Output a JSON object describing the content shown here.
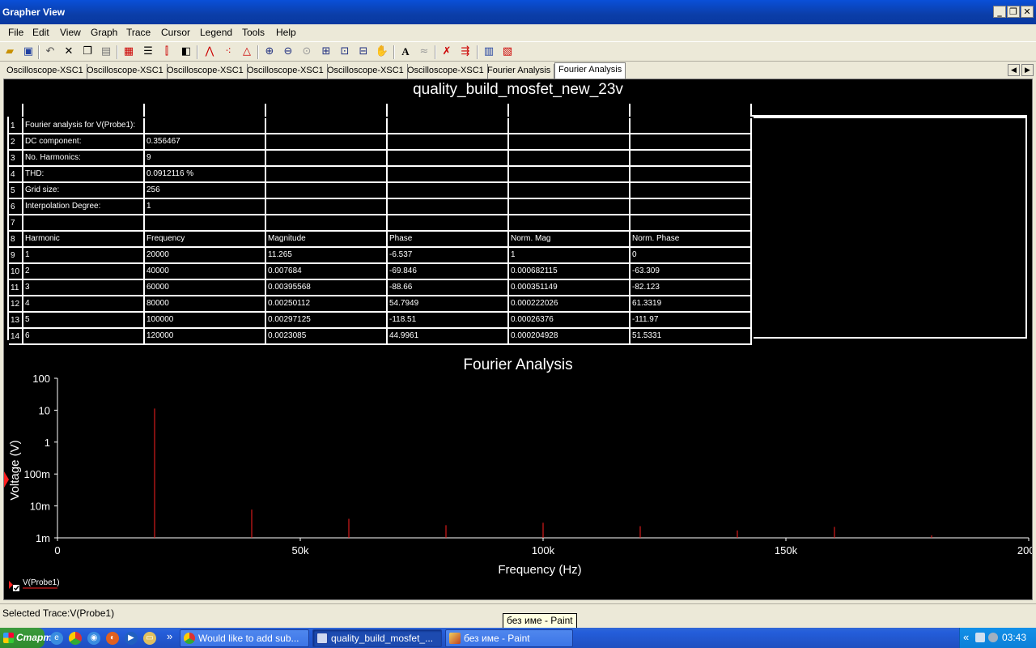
{
  "window": {
    "title": "Grapher View",
    "buttons": {
      "minimize": "_",
      "restore": "❐",
      "close": "✕"
    }
  },
  "menu": [
    "File",
    "Edit",
    "View",
    "Graph",
    "Trace",
    "Cursor",
    "Legend",
    "Tools",
    "Help"
  ],
  "toolbar_icons": [
    "open-icon",
    "save-icon",
    "undo-icon",
    "cut-icon",
    "copy-icon",
    "paste-icon",
    "grid-icon",
    "legend-icon",
    "cursors-icon",
    "overlay-icon",
    "lines-icon",
    "dots-icon",
    "lines-dots-icon",
    "zoom-in-icon",
    "zoom-out-icon",
    "zoom-full-icon",
    "zoom-area-icon",
    "zoom-x-icon",
    "zoom-y-icon",
    "pan-icon",
    "text-icon",
    "trace-label-icon",
    "trace-props-icon",
    "export-icon",
    "clipboard-icon",
    "print-icon"
  ],
  "tabs": [
    "Oscilloscope-XSC1",
    "Oscilloscope-XSC1",
    "Oscilloscope-XSC1",
    "Oscilloscope-XSC1",
    "Oscilloscope-XSC1",
    "Oscilloscope-XSC1",
    "Fourier Analysis",
    "Fourier Analysis"
  ],
  "tab_nav": {
    "prev": "◀",
    "next": "▶"
  },
  "document_title": "quality_build_mosfet_new_23v",
  "table": {
    "rows": [
      [
        "1",
        "Fourier analysis for V(Probe1):",
        "",
        "",
        "",
        "",
        ""
      ],
      [
        "2",
        "DC component:",
        "0.356467",
        "",
        "",
        "",
        ""
      ],
      [
        "3",
        "No. Harmonics:",
        "9",
        "",
        "",
        "",
        ""
      ],
      [
        "4",
        "THD:",
        "0.0912116 %",
        "",
        "",
        "",
        ""
      ],
      [
        "5",
        "Grid size:",
        "256",
        "",
        "",
        "",
        ""
      ],
      [
        "6",
        "Interpolation Degree:",
        "1",
        "",
        "",
        "",
        ""
      ],
      [
        "7",
        "",
        "",
        "",
        "",
        "",
        ""
      ],
      [
        "8",
        "Harmonic",
        "Frequency",
        "Magnitude",
        "Phase",
        "Norm. Mag",
        "Norm. Phase"
      ],
      [
        "9",
        "1",
        "20000",
        "11.265",
        "-6.537",
        "1",
        "0"
      ],
      [
        "10",
        "2",
        "40000",
        "0.007684",
        "-69.846",
        "0.000682115",
        "-63.309"
      ],
      [
        "11",
        "3",
        "60000",
        "0.00395568",
        "-88.66",
        "0.000351149",
        "-82.123"
      ],
      [
        "12",
        "4",
        "80000",
        "0.00250112",
        "54.7949",
        "0.000222026",
        "61.3319"
      ],
      [
        "13",
        "5",
        "100000",
        "0.00297125",
        "-118.51",
        "0.00026376",
        "-111.97"
      ],
      [
        "14",
        "6",
        "120000",
        "0.0023085",
        "44.9961",
        "0.000204928",
        "51.5331"
      ]
    ]
  },
  "chart_data": {
    "type": "bar",
    "title": "Fourier Analysis",
    "xlabel": "Frequency (Hz)",
    "ylabel": "Voltage (V)",
    "yscale": "log",
    "xlim": [
      0,
      200000
    ],
    "ylim": [
      0.001,
      100
    ],
    "x_ticks": [
      "0",
      "50k",
      "100k",
      "150k",
      "200k"
    ],
    "x_tick_values": [
      0,
      50000,
      100000,
      150000,
      200000
    ],
    "y_ticks": [
      "100",
      "10",
      "1",
      "100m",
      "10m",
      "1m"
    ],
    "y_tick_values": [
      100,
      10,
      1,
      0.1,
      0.01,
      0.001
    ],
    "series": [
      {
        "name": "V(Probe1)",
        "color": "#ff2020",
        "x": [
          20000,
          40000,
          60000,
          80000,
          100000,
          120000,
          140000,
          160000,
          180000
        ],
        "values": [
          11.265,
          0.007684,
          0.00395568,
          0.00250112,
          0.00297125,
          0.0023085,
          0.0017,
          0.0022,
          0.0012
        ]
      }
    ],
    "grid": false,
    "legend": "bottom-left"
  },
  "legend": {
    "label": "V(Probe1)"
  },
  "status": {
    "text": "Selected Trace:V(Probe1)"
  },
  "tooltip": "без име - Paint",
  "taskbar": {
    "start": "Старт",
    "overflow": "»",
    "tasks": [
      "Would like to add sub...",
      "quality_build_mosfet_...",
      "без име - Paint"
    ],
    "tray_chevron": "«",
    "clock": "03:43"
  }
}
